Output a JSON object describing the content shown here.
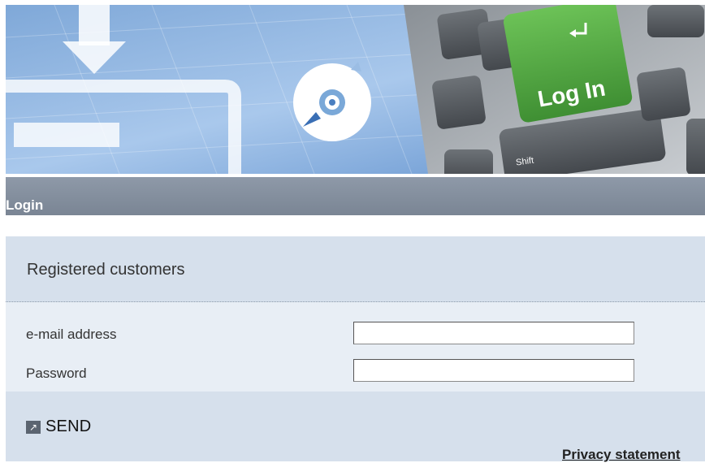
{
  "banner": {
    "key_label": "Log In",
    "shift_label": "Shift"
  },
  "page": {
    "title": "Login"
  },
  "login_form": {
    "section_title": "Registered customers",
    "email_label": "e-mail address",
    "email_value": "",
    "password_label": "Password",
    "password_value": "",
    "send_label": "SEND",
    "send_icon": "arrow-out-icon"
  },
  "footer": {
    "privacy_link": "Privacy statement"
  },
  "colors": {
    "title_bar": "#7e8997",
    "panel_dark": "#d6e0ec",
    "panel_light": "#e8eef5",
    "key_green": "#5aa846"
  }
}
